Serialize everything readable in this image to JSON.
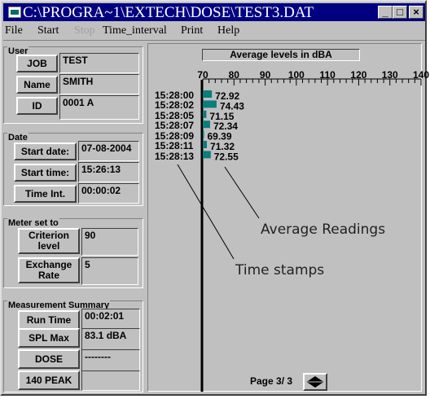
{
  "window": {
    "title": "C:\\PROGRA~1\\EXTECH\\DOSE\\TEST3.DAT",
    "minimize": "_",
    "maximize": "□",
    "close": "×"
  },
  "menu": {
    "items": [
      "File",
      "Start",
      "Stop",
      "Time_interval",
      "Print",
      "Help"
    ],
    "disabled": [
      "Stop"
    ]
  },
  "user": {
    "title": "User",
    "fields": [
      {
        "label": "JOB",
        "value": "TEST"
      },
      {
        "label": "Name",
        "value": "SMITH"
      },
      {
        "label": "ID",
        "value": "0001 A"
      }
    ]
  },
  "date": {
    "title": "Date",
    "fields": [
      {
        "label": "Start date:",
        "value": "07-08-2004"
      },
      {
        "label": "Start time:",
        "value": "15:26:13"
      },
      {
        "label": "Time Int.",
        "value": "00:00:02"
      }
    ]
  },
  "meter": {
    "title": "Meter set to",
    "fields": [
      {
        "label": "Criterion level",
        "value": "90"
      },
      {
        "label": "Exchange Rate",
        "value": "5"
      }
    ]
  },
  "summary": {
    "title": "Measurement Summary",
    "fields": [
      {
        "label": "Run Time",
        "value": "00:02:01"
      },
      {
        "label": "SPL Max",
        "value": "83.1 dBA"
      },
      {
        "label": "DOSE",
        "value": "--------"
      },
      {
        "label": "140 PEAK",
        "value": ""
      }
    ]
  },
  "chart_data": {
    "type": "bar",
    "title": "Average levels in dBA",
    "categories": [
      "15:28:00",
      "15:28:02",
      "15:28:05",
      "15:28:07",
      "15:28:09",
      "15:28:11",
      "15:28:13"
    ],
    "values": [
      72.92,
      74.43,
      71.15,
      72.34,
      69.39,
      71.32,
      72.55
    ],
    "value_labels": [
      "72.92",
      "74.43",
      "71.15",
      "72.34",
      "69.39",
      "71.32",
      "72.55"
    ],
    "xlim": [
      70,
      140
    ],
    "xticks": [
      "70",
      "80",
      "90",
      "100",
      "110",
      "120",
      "130",
      "140"
    ],
    "bar_color": "#0b7d7d",
    "grid": false
  },
  "pager": {
    "label": "Page  3/ 3"
  },
  "annotations": {
    "readings": "Average Readings",
    "timestamps": "Time stamps"
  }
}
